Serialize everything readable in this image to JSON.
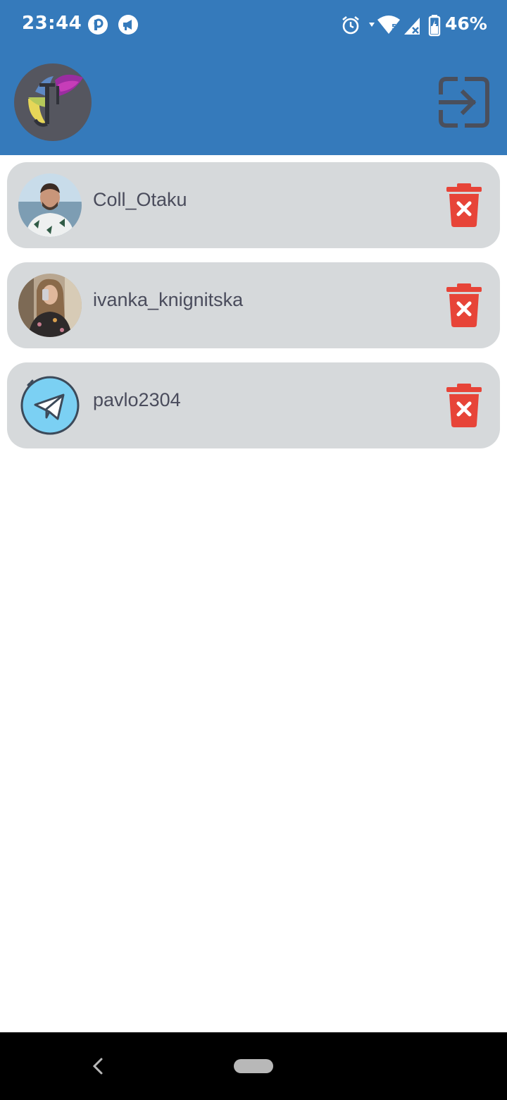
{
  "status_bar": {
    "time": "23:44",
    "battery": "46%",
    "icons": [
      "pinterest-icon",
      "megaphone-icon",
      "alarm-icon",
      "wifi-icon",
      "signal-icon",
      "battery-charging-icon"
    ]
  },
  "header": {
    "logo_icon": "app-logo-icon",
    "logout_icon": "logout-icon",
    "background_color": "#357abb"
  },
  "users": [
    {
      "name": "Coll_Otaku",
      "avatar": "photo"
    },
    {
      "name": "ivanka_knignitska",
      "avatar": "photo"
    },
    {
      "name": "pavlo2304",
      "avatar": "telegram-icon"
    }
  ],
  "delete_icon": "trash-icon",
  "colors": {
    "card_background": "#d6d9db",
    "delete_red": "#e74438",
    "text": "#4a4c5c"
  }
}
